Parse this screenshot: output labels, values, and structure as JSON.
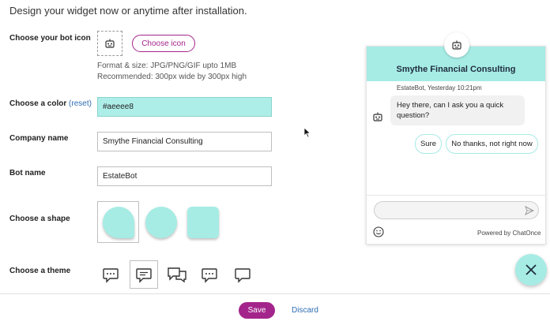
{
  "page": {
    "title": "Design your widget now or anytime after installation."
  },
  "form": {
    "bot_icon_label": "Choose your bot icon",
    "choose_icon_button": "Choose icon",
    "format_line1": "Format & size: JPG/PNG/GIF upto 1MB",
    "format_line2": "Recommended: 300px wide by 300px high",
    "color_label": "Choose a color",
    "color_reset": "(reset)",
    "color_value": "#aeeee8",
    "company_label": "Company name",
    "company_value": "Smythe Financial Consulting",
    "bot_name_label": "Bot name",
    "bot_name_value": "EstateBot",
    "shape_label": "Choose a shape",
    "theme_label": "Choose a theme"
  },
  "footer": {
    "save": "Save",
    "discard": "Discard"
  },
  "widget": {
    "title": "Smythe Financial Consulting",
    "meta": "EstateBot, Yesterday 10:21pm",
    "message_line1": "Hey there, can I ask you a quick",
    "message_line2": "question?",
    "reply_yes": "Sure",
    "reply_no": "No thanks, not right now",
    "powered_by": "Powered by ChatOnce"
  },
  "colors": {
    "accent": "#a3258b",
    "widget_color": "#a6ece5",
    "link": "#2d6db3"
  },
  "icons": [
    "bot-icon",
    "speech-bubble-icon",
    "send-icon",
    "smiley-icon",
    "close-icon"
  ]
}
